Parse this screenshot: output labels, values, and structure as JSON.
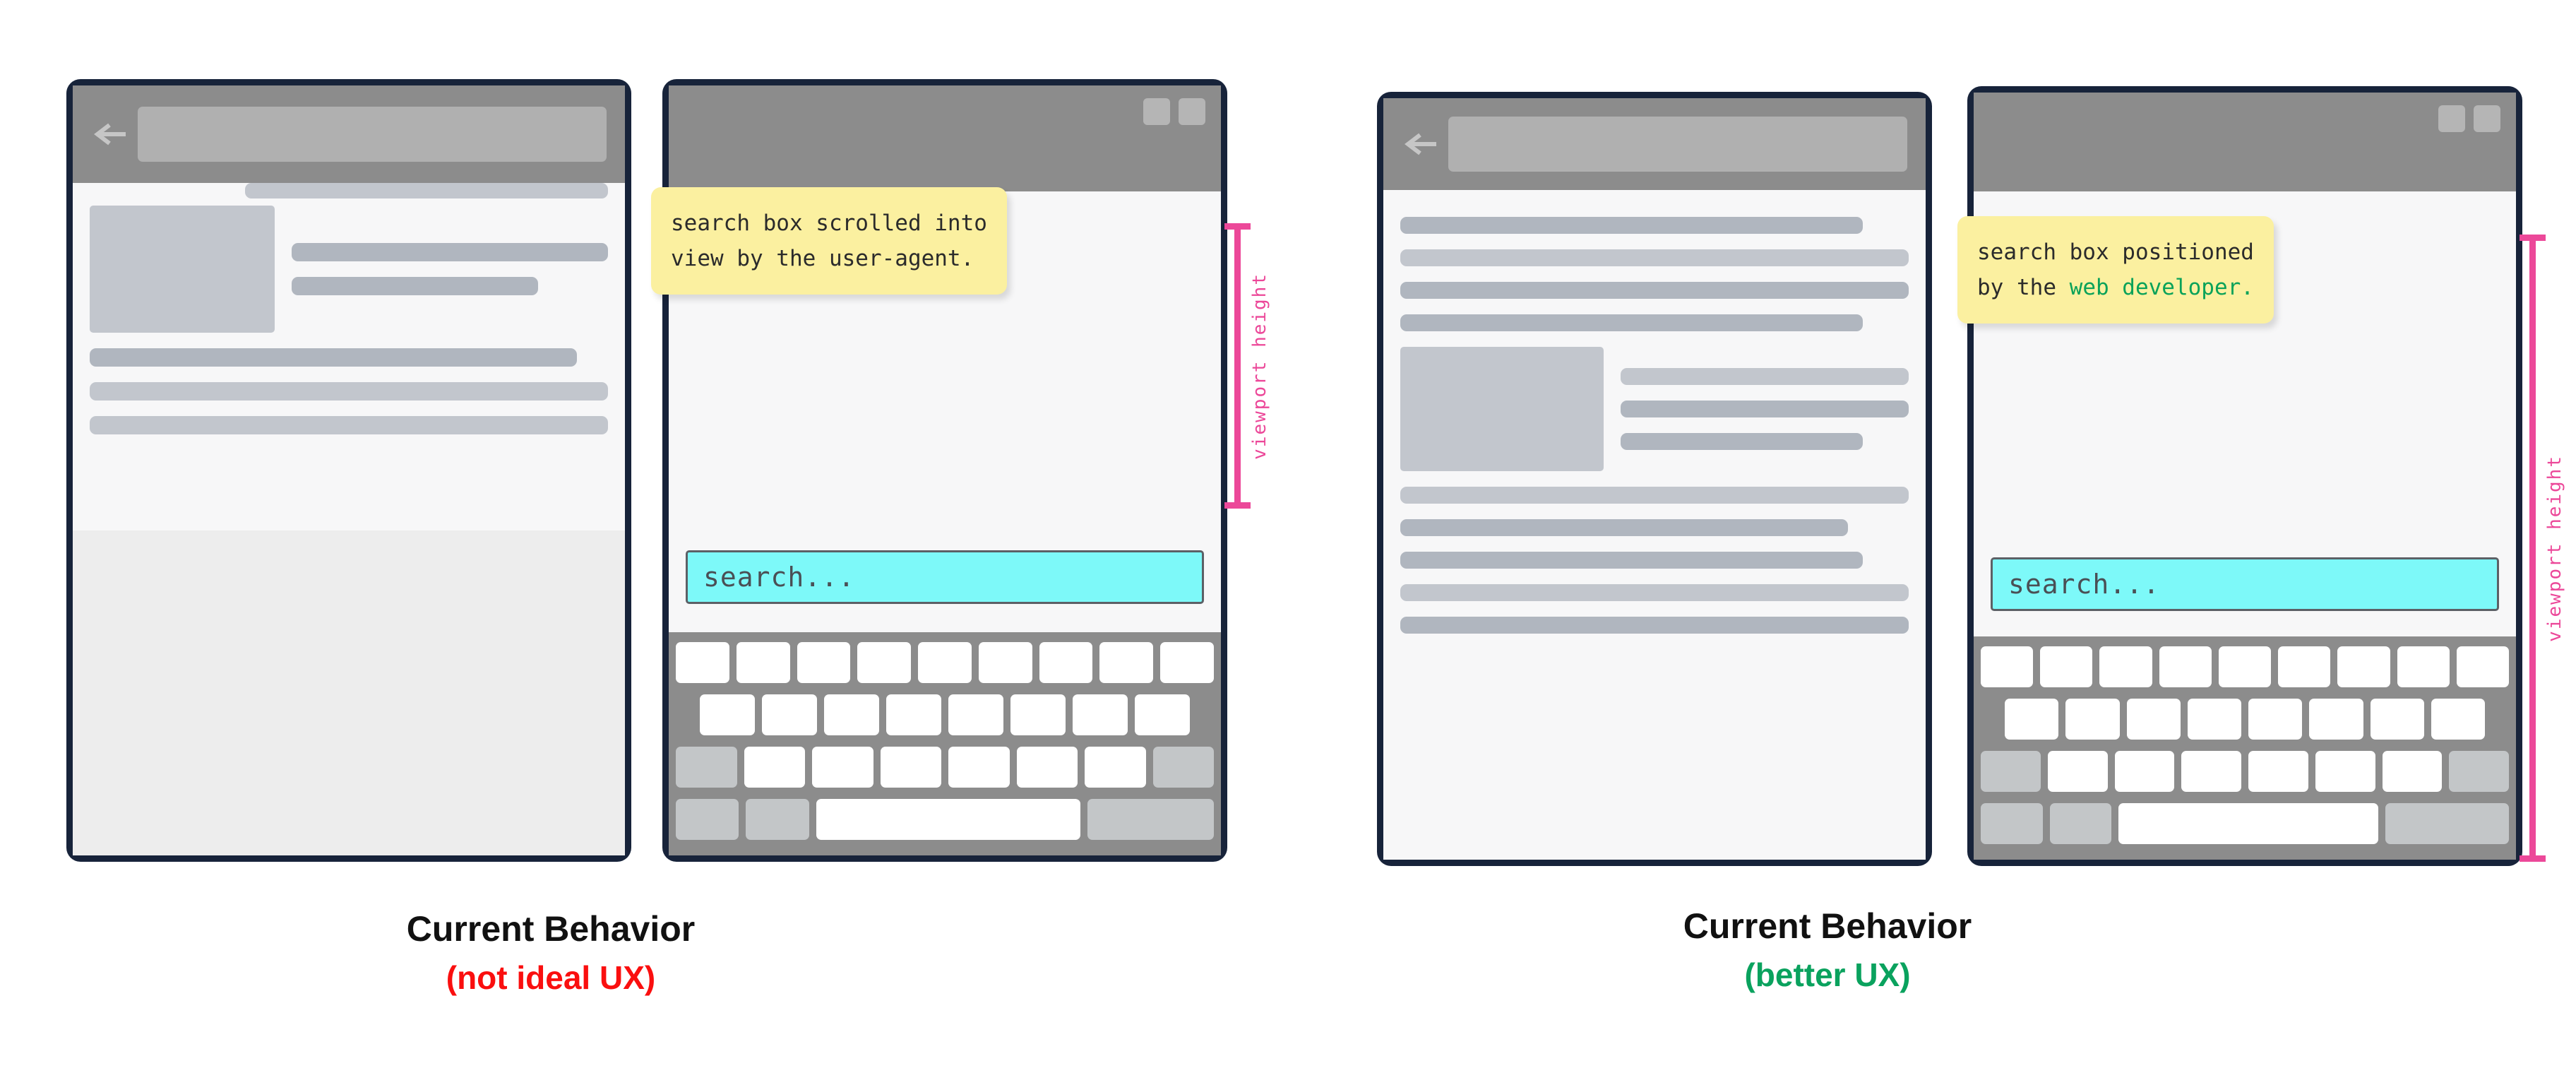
{
  "accent_colors": {
    "frame": "#17233a",
    "chrome": "#8c8c8c",
    "callout_bg": "#fbf0a0",
    "search_bg": "#7df9f9",
    "bracket_pink": "#ec4899",
    "bad_red": "#fa0f0f",
    "good_green": "#0aa25e",
    "highlight_green": "#0aa259"
  },
  "left_group": {
    "caption_main": "Current Behavior",
    "caption_sub": "(not ideal UX)",
    "phone_a": {
      "back_icon": "back-arrow-icon",
      "url_bar_value": ""
    },
    "phone_b": {
      "callout_line1": "search box scrolled into",
      "callout_line2": "view by the user-agent.",
      "search_placeholder": "search...",
      "chrome_square_1": "tab-square-icon",
      "chrome_square_2": "tab-square-icon"
    },
    "bracket_label": "viewport height"
  },
  "right_group": {
    "caption_main": "Current Behavior",
    "caption_sub": "(better UX)",
    "phone_c": {
      "back_icon": "back-arrow-icon",
      "url_bar_value": ""
    },
    "phone_d": {
      "callout_line1": "search box positioned",
      "callout_line2_plain": "by the ",
      "callout_line2_highlight": "web developer.",
      "search_placeholder": "search...",
      "chrome_square_1": "tab-square-icon",
      "chrome_square_2": "tab-square-icon"
    },
    "bracket_label": "viewport height"
  }
}
